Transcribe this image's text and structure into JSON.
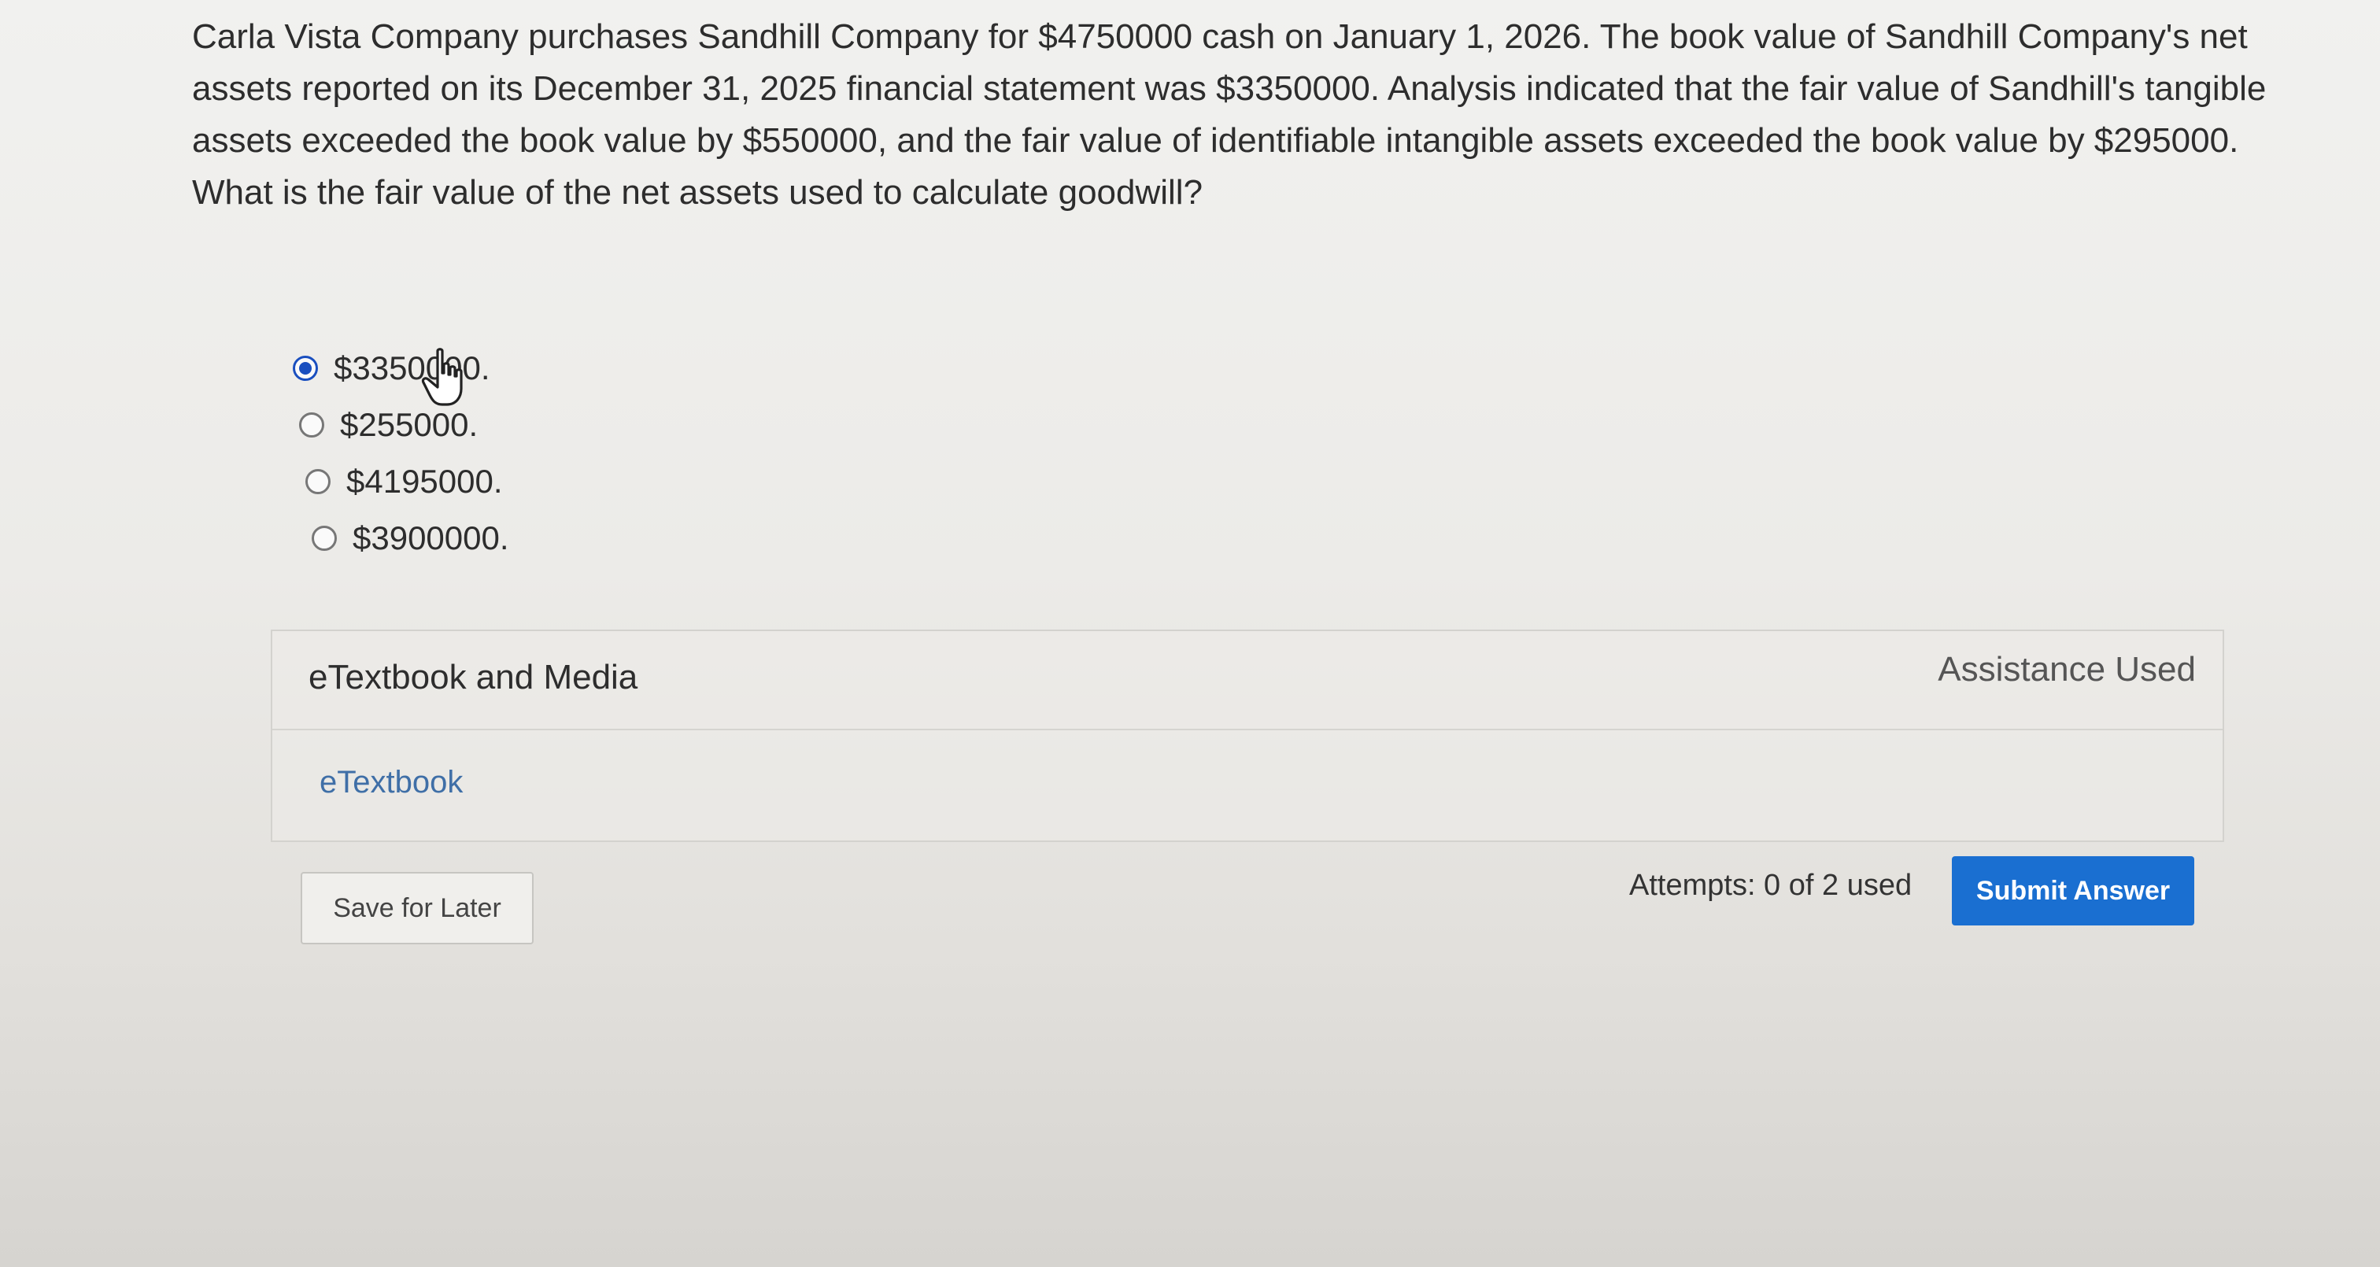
{
  "question": {
    "text": "Carla Vista Company purchases Sandhill Company for $4750000 cash on January 1, 2026. The book value of Sandhill Company's net assets reported on its December 31, 2025 financial statement was $3350000. Analysis indicated that the fair value of Sandhill's tangible assets exceeded the book value by $550000, and the fair value of identifiable intangible assets exceeded the book value by $295000. What is the fair value of the net assets used to calculate goodwill?"
  },
  "options": [
    {
      "label": "$3350000.",
      "selected": true
    },
    {
      "label": "$255000.",
      "selected": false
    },
    {
      "label": "$4195000.",
      "selected": false
    },
    {
      "label": "$3900000.",
      "selected": false
    }
  ],
  "panel": {
    "title": "eTextbook and Media",
    "assistance": "Assistance Used",
    "link": "eTextbook"
  },
  "footer": {
    "save_label": "Save for Later",
    "attempts": "Attempts: 0 of 2 used",
    "submit_label": "Submit Answer"
  },
  "colors": {
    "accent": "#1a6fd1",
    "radio_selected": "#1a4fbf",
    "link": "#3f6fa7"
  }
}
